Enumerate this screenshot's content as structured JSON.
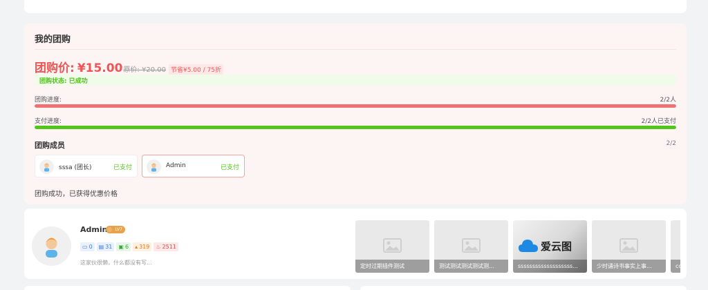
{
  "group": {
    "title": "我的团购",
    "price_label": "团购价:",
    "price": "¥15.00",
    "original": "原价: ¥20.00",
    "saving": "节省¥5.00 / 75折",
    "status": "团购状态: 已成功",
    "progress": {
      "label": "团购进度:",
      "value": "2/2人",
      "fraction": 1.0,
      "color": "#f07171"
    },
    "payment": {
      "label": "支付进度:",
      "value": "2/2人已支付",
      "fraction": 1.0,
      "color": "#52c41a"
    },
    "members_title": "团购成员",
    "members_count": "2/2",
    "members": [
      {
        "name": "sssa (团长)",
        "status": "已支付"
      },
      {
        "name": "Admin",
        "status": "已支付"
      }
    ],
    "success_msg": "团购成功，已获得优惠价格"
  },
  "profile": {
    "name": "Admin",
    "level": "LV7",
    "stats": [
      {
        "icon": "comment-icon",
        "value": "0",
        "color": "#3b7ddd",
        "bg": "#e8f0fd"
      },
      {
        "icon": "document-icon",
        "value": "31",
        "color": "#3b7ddd",
        "bg": "#e8f0fd"
      },
      {
        "icon": "chat-icon",
        "value": "6",
        "color": "#3aa63a",
        "bg": "#e7f6e7"
      },
      {
        "icon": "thumbs-up-icon",
        "value": "319",
        "color": "#e07b1a",
        "bg": "#fdf0e2"
      },
      {
        "icon": "fire-icon",
        "value": "2511",
        "color": "#e04848",
        "bg": "#fde8e8"
      }
    ],
    "bio": "这家伙很懒，什么都没有写..."
  },
  "thumbs": [
    {
      "caption": "定时过期插件测试"
    },
    {
      "caption": "测试测试测试测试测..."
    },
    {
      "caption": "sssssssssssssssssss...",
      "logo": "爱云图"
    },
    {
      "caption": "少时诵诗书事实上事..."
    },
    {
      "caption": "cc"
    }
  ]
}
